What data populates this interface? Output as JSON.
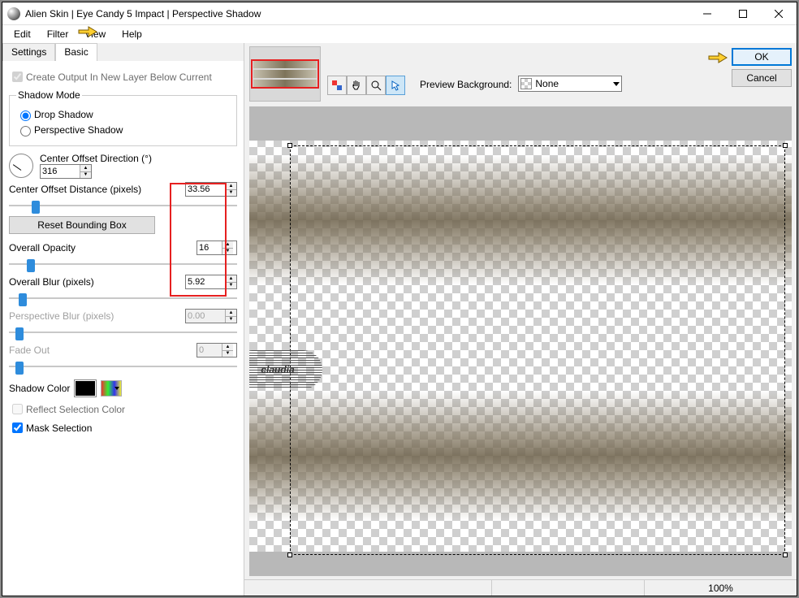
{
  "title": "Alien Skin | Eye Candy 5 Impact | Perspective Shadow",
  "menu": {
    "edit": "Edit",
    "filter": "Filter",
    "view": "View",
    "help": "Help"
  },
  "tabs": {
    "settings": "Settings",
    "basic": "Basic"
  },
  "create_output": "Create Output In New Layer Below Current",
  "shadow_mode": {
    "legend": "Shadow Mode",
    "drop": "Drop Shadow",
    "perspective": "Perspective Shadow"
  },
  "dir": {
    "label": "Center Offset Direction (°)",
    "value": "316"
  },
  "offset": {
    "label": "Center Offset Distance (pixels)",
    "value": "33.56"
  },
  "reset": "Reset Bounding Box",
  "opacity": {
    "label": "Overall Opacity",
    "value": "16"
  },
  "blur": {
    "label": "Overall Blur (pixels)",
    "value": "5.92"
  },
  "pblur": {
    "label": "Perspective Blur (pixels)",
    "value": "0.00"
  },
  "fade": {
    "label": "Fade Out",
    "value": "0"
  },
  "color_label": "Shadow Color",
  "reflect": "Reflect Selection Color",
  "mask": "Mask Selection",
  "preview_bg": {
    "label": "Preview Background:",
    "value": "None"
  },
  "ok": "OK",
  "cancel": "Cancel",
  "zoom": "100%",
  "watermark": "claudia"
}
